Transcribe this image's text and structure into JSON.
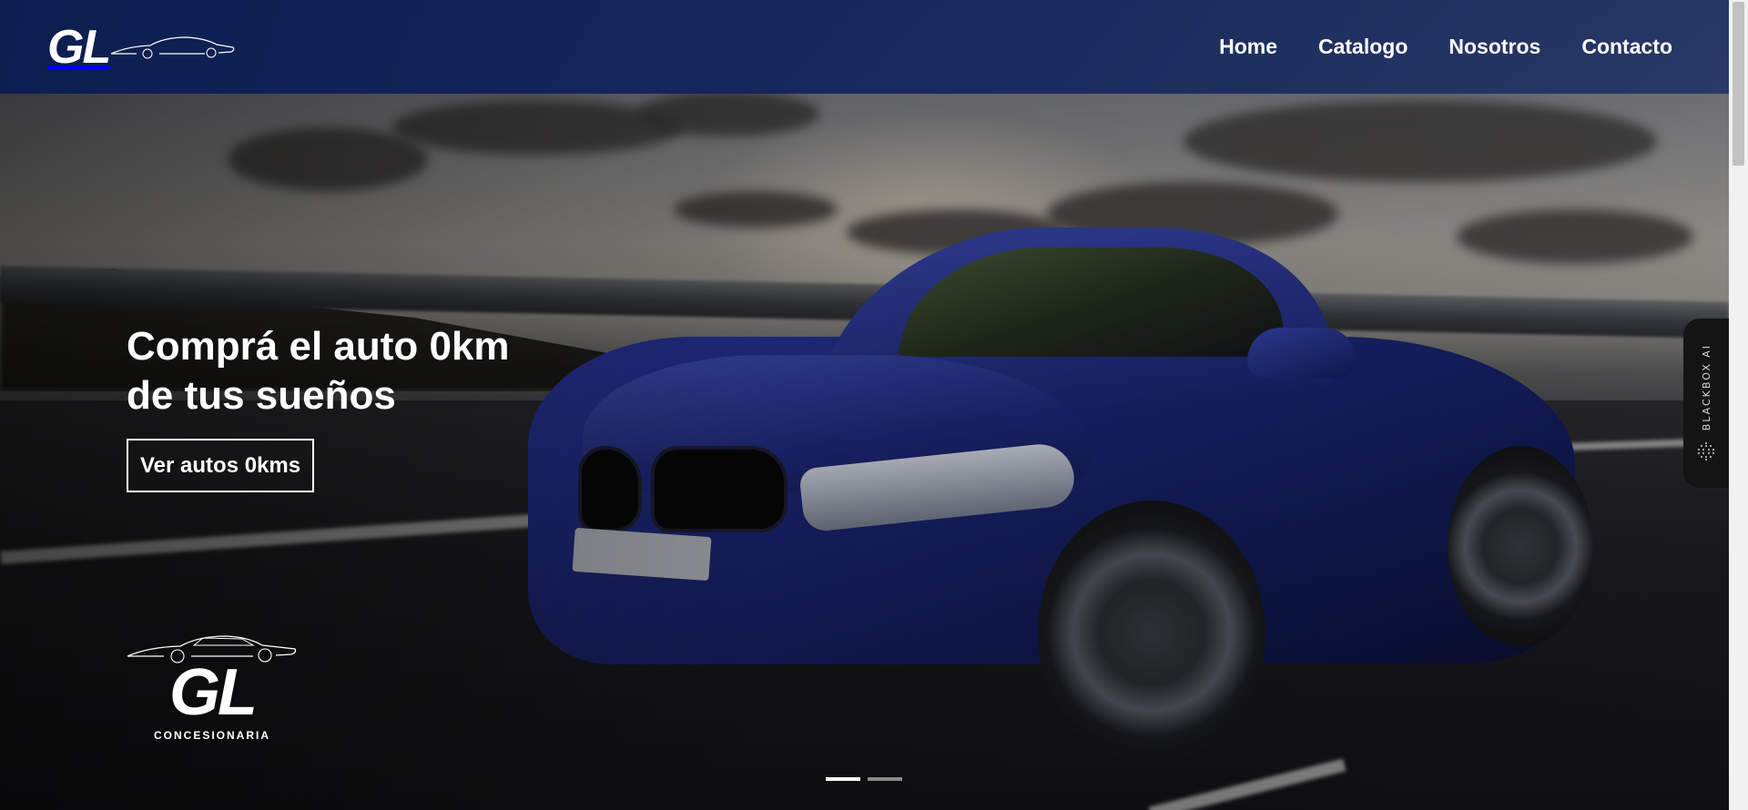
{
  "header": {
    "logo_text": "GL",
    "nav": [
      {
        "label": "Home"
      },
      {
        "label": "Catalogo"
      },
      {
        "label": "Nosotros"
      },
      {
        "label": "Contacto"
      }
    ]
  },
  "hero": {
    "title_line1": "Comprá el auto 0km",
    "title_line2": "de tus sueños",
    "cta_label": "Ver autos 0kms",
    "slides_total": 2,
    "slide_active": 1
  },
  "footer_logo": {
    "text": "GL",
    "subtitle": "CONCESIONARIA"
  },
  "side_widget": {
    "label": "BLACKBOX AI"
  },
  "colors": {
    "header_bg": "#0a1e50",
    "text": "#ffffff",
    "car_blue": "#1b2676"
  }
}
